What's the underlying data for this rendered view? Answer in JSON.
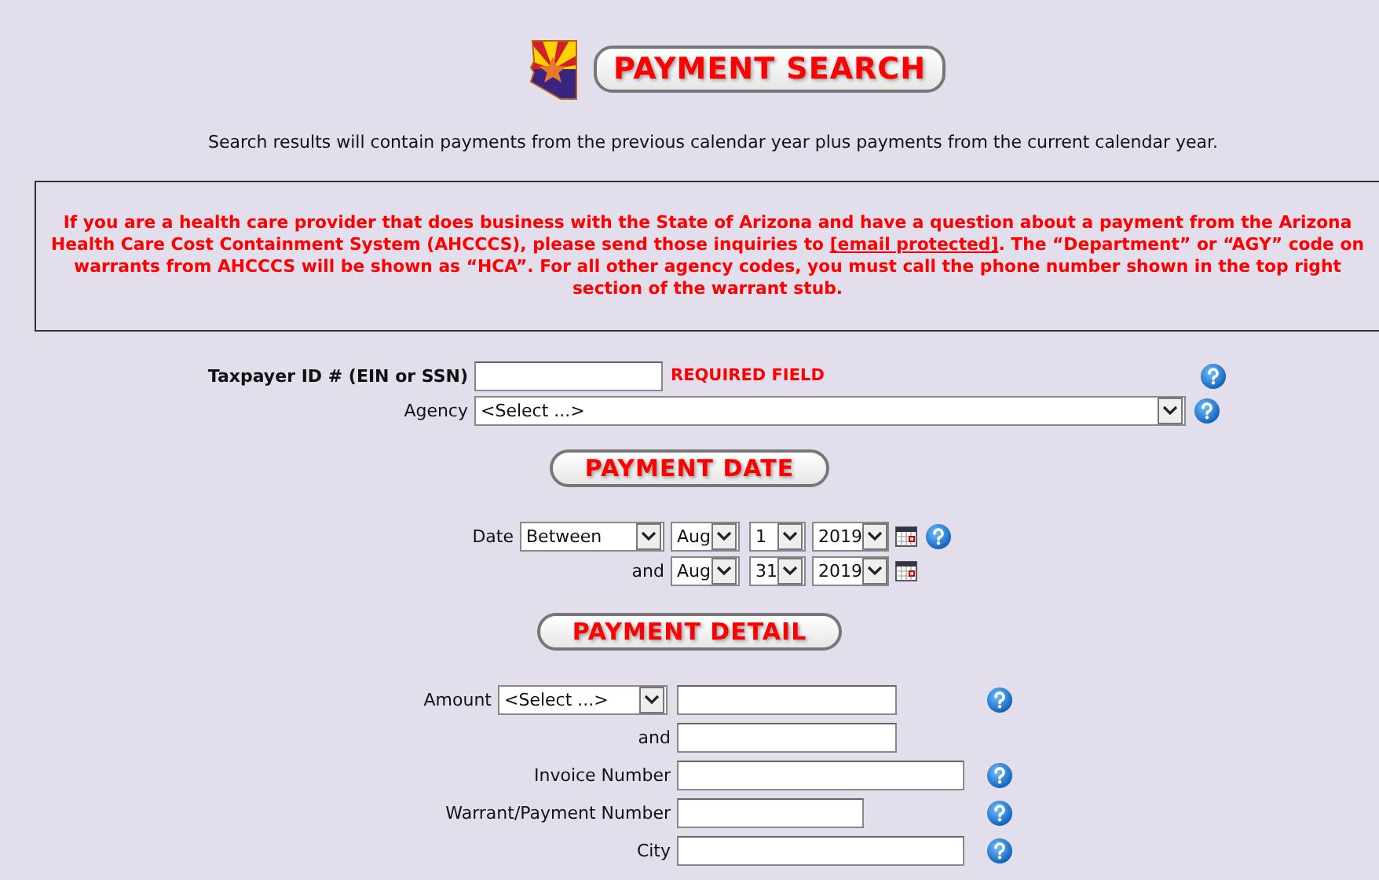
{
  "header": {
    "title": "PAYMENT SEARCH",
    "intro": "Search results will contain payments from the previous calendar year plus payments from the current calendar year."
  },
  "notice": {
    "text_before": "If you are a health care provider that does business with the State of Arizona and have a question about a payment from the Arizona Health Care Cost Containment System (AHCCCS), please send those inquiries to",
    "link": "[email protected]",
    "text_after": ". The “Department” or “AGY” code on warrants from AHCCCS will be shown as “HCA”. For all other agency codes, you must call the phone number shown in the top right section of the warrant stub."
  },
  "search": {
    "taxpayer": {
      "label": "Taxpayer ID # (EIN or SSN)",
      "required": "REQUIRED FIELD"
    },
    "agency": {
      "label": "Agency",
      "value": "<Select ...>"
    }
  },
  "payment_date": {
    "heading": "PAYMENT DATE",
    "rows": [
      {
        "label": "Date",
        "mode": "Between",
        "month": "Aug",
        "day": "1",
        "year": "2019",
        "help": true
      },
      {
        "label": "and",
        "month": "Aug",
        "day": "31",
        "year": "2019",
        "help": false
      }
    ]
  },
  "payment_detail": {
    "heading": "PAYMENT DETAIL",
    "fields": [
      {
        "kind": "amount",
        "label": "Amount",
        "operator": "<Select ...>",
        "help": true
      },
      {
        "kind": "text",
        "label": "and",
        "help": false
      },
      {
        "kind": "text",
        "label": "Invoice Number",
        "help": true
      },
      {
        "kind": "text",
        "label": "Warrant/Payment Number",
        "help": true
      },
      {
        "kind": "text",
        "label": "City",
        "help": true
      }
    ]
  }
}
